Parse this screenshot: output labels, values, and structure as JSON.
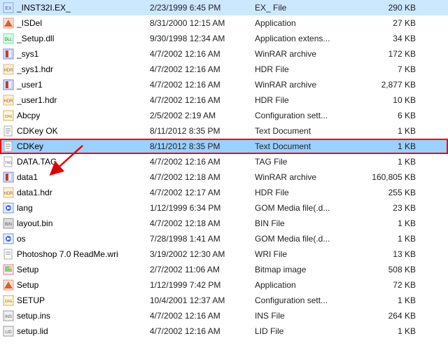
{
  "files": [
    {
      "name": "_INST32I.EX_",
      "date": "2/23/1999 6:45 PM",
      "type": "EX_ File",
      "size": "290 KB",
      "icon": "exe",
      "selected": false
    },
    {
      "name": "_ISDel",
      "date": "8/31/2000 12:15 AM",
      "type": "Application",
      "size": "27 KB",
      "icon": "app",
      "selected": false
    },
    {
      "name": "_Setup.dll",
      "date": "9/30/1998 12:34 AM",
      "type": "Application extens...",
      "size": "34 KB",
      "icon": "dll",
      "selected": false
    },
    {
      "name": "_sys1",
      "date": "4/7/2002 12:16 AM",
      "type": "WinRAR archive",
      "size": "172 KB",
      "icon": "rar",
      "selected": false
    },
    {
      "name": "_sys1.hdr",
      "date": "4/7/2002 12:16 AM",
      "type": "HDR File",
      "size": "7 KB",
      "icon": "hdr",
      "selected": false
    },
    {
      "name": "_user1",
      "date": "4/7/2002 12:16 AM",
      "type": "WinRAR archive",
      "size": "2,877 KB",
      "icon": "rar",
      "selected": false
    },
    {
      "name": "_user1.hdr",
      "date": "4/7/2002 12:16 AM",
      "type": "HDR File",
      "size": "10 KB",
      "icon": "hdr",
      "selected": false
    },
    {
      "name": "Abcpy",
      "date": "2/5/2002 2:19 AM",
      "type": "Configuration sett...",
      "size": "6 KB",
      "icon": "cfg",
      "selected": false
    },
    {
      "name": "CDKey OK",
      "date": "8/11/2012 8:35 PM",
      "type": "Text Document",
      "size": "1 KB",
      "icon": "txt",
      "selected": false
    },
    {
      "name": "CDKey",
      "date": "8/11/2012 8:35 PM",
      "type": "Text Document",
      "size": "1 KB",
      "icon": "txt",
      "selected": true,
      "highlighted": true
    },
    {
      "name": "DATA.TAG",
      "date": "4/7/2002 12:16 AM",
      "type": "TAG File",
      "size": "1 KB",
      "icon": "tag",
      "selected": false
    },
    {
      "name": "data1",
      "date": "4/7/2002 12:18 AM",
      "type": "WinRAR archive",
      "size": "160,805 KB",
      "icon": "rar",
      "selected": false
    },
    {
      "name": "data1.hdr",
      "date": "4/7/2002 12:17 AM",
      "type": "HDR File",
      "size": "255 KB",
      "icon": "hdr",
      "selected": false
    },
    {
      "name": "lang",
      "date": "1/12/1999 6:34 PM",
      "type": "GOM Media file(.d...",
      "size": "23 KB",
      "icon": "gom",
      "selected": false
    },
    {
      "name": "layout.bin",
      "date": "4/7/2002 12:18 AM",
      "type": "BIN File",
      "size": "1 KB",
      "icon": "bin",
      "selected": false
    },
    {
      "name": "os",
      "date": "7/28/1998 1:41 AM",
      "type": "GOM Media file(.d...",
      "size": "1 KB",
      "icon": "gom",
      "selected": false
    },
    {
      "name": "Photoshop 7.0 ReadMe.wri",
      "date": "3/19/2002 12:30 AM",
      "type": "WRI File",
      "size": "13 KB",
      "icon": "wri",
      "selected": false
    },
    {
      "name": "Setup",
      "date": "2/7/2002 11:06 AM",
      "type": "Bitmap image",
      "size": "508 KB",
      "icon": "bmp",
      "selected": false
    },
    {
      "name": "Setup",
      "date": "1/12/1999 7:42 PM",
      "type": "Application",
      "size": "72 KB",
      "icon": "app",
      "selected": false
    },
    {
      "name": "SETUP",
      "date": "10/4/2001 12:37 AM",
      "type": "Configuration sett...",
      "size": "1 KB",
      "icon": "cfg",
      "selected": false
    },
    {
      "name": "setup.ins",
      "date": "4/7/2002 12:16 AM",
      "type": "INS File",
      "size": "264 KB",
      "icon": "ins",
      "selected": false
    },
    {
      "name": "setup.lid",
      "date": "4/7/2002 12:16 AM",
      "type": "LID File",
      "size": "1 KB",
      "icon": "lid",
      "selected": false
    }
  ]
}
